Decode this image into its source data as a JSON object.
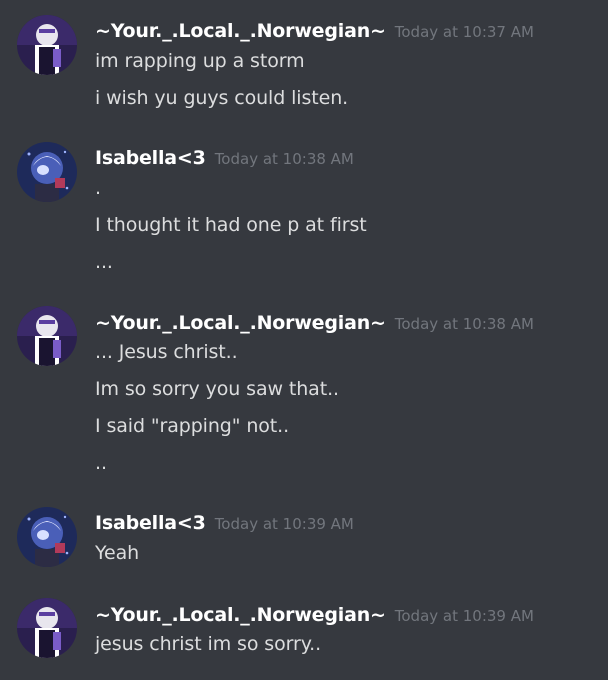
{
  "colors": {
    "background": "#36393f",
    "username": "#ffffff",
    "message_text": "#dcddde",
    "timestamp": "#72767d"
  },
  "messages": [
    {
      "author": "~Your._.Local._.Norwegian~",
      "avatar_icon": "norwegian-avatar-icon",
      "timestamp": "Today at 10:37 AM",
      "lines": [
        "im rapping up a storm",
        "i wish yu guys could listen."
      ]
    },
    {
      "author": "Isabella<3",
      "avatar_icon": "isabella-avatar-icon",
      "timestamp": "Today at 10:38 AM",
      "lines": [
        ".",
        "I thought it had one p at first",
        "..."
      ]
    },
    {
      "author": "~Your._.Local._.Norwegian~",
      "avatar_icon": "norwegian-avatar-icon",
      "timestamp": "Today at 10:38 AM",
      "lines": [
        "... Jesus christ..",
        "Im so sorry you saw that..",
        "I said \"rapping\" not..",
        ".."
      ]
    },
    {
      "author": "Isabella<3",
      "avatar_icon": "isabella-avatar-icon",
      "timestamp": "Today at 10:39 AM",
      "lines": [
        "Yeah"
      ]
    },
    {
      "author": "~Your._.Local._.Norwegian~",
      "avatar_icon": "norwegian-avatar-icon",
      "timestamp": "Today at 10:39 AM",
      "lines": [
        "jesus christ im so sorry.."
      ]
    }
  ]
}
